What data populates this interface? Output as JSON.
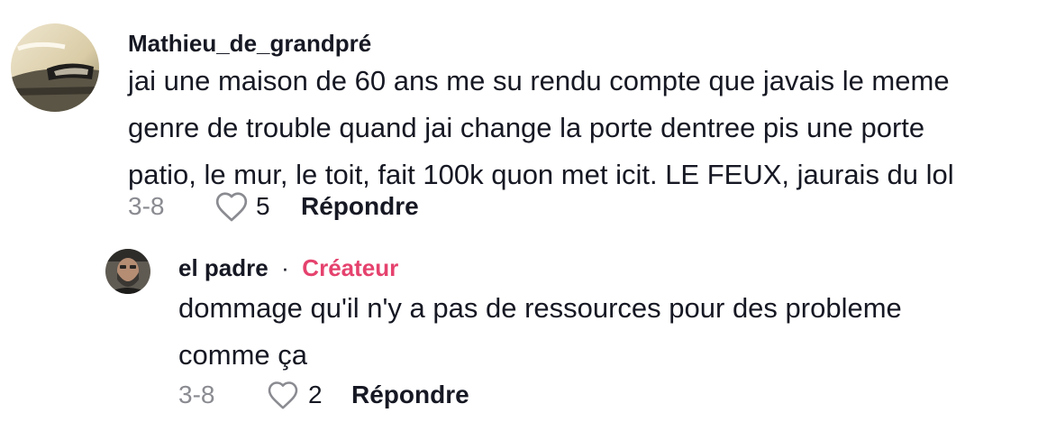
{
  "comments": [
    {
      "username": "Mathieu_de_grandpré",
      "lines": [
        "jai une maison de 60 ans me su rendu compte que javais le meme",
        "genre de trouble quand jai change la porte dentree pis une porte",
        "patio, le mur, le toit, fait 100k quon met icit. LE FEUX, jaurais du lol"
      ],
      "date": "3-8",
      "likes": "5",
      "reply_label": "Répondre",
      "avatar_icon": "car-headlight-avatar"
    }
  ],
  "replies": [
    {
      "username": "el padre",
      "separator": "·",
      "badge": "Créateur",
      "lines": [
        "dommage qu'il n'y a pas de ressources pour des probleme",
        "comme ça"
      ],
      "date": "3-8",
      "likes": "2",
      "reply_label": "Répondre",
      "avatar_icon": "bearded-man-avatar"
    }
  ],
  "icons": {
    "like": "heart-outline-icon"
  },
  "colors": {
    "text": "#161823",
    "meta": "#8a8b91",
    "creator_badge": "#e5426e"
  }
}
